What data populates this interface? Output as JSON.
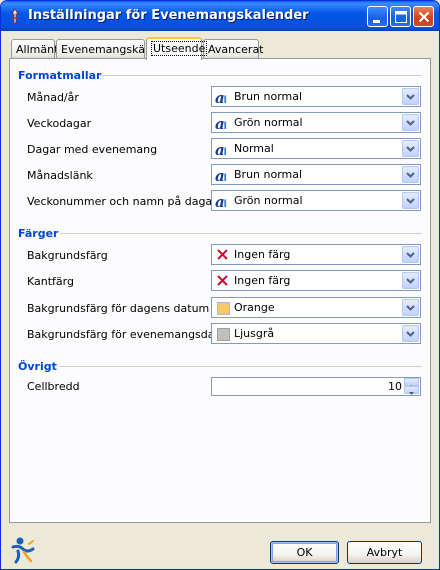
{
  "window": {
    "title": "Inställningar för Evenemangskalender"
  },
  "tabs": [
    {
      "label": "Allmänt"
    },
    {
      "label": "Evenemangskälla"
    },
    {
      "label": "Utseende",
      "active": true
    },
    {
      "label": "Avancerat"
    }
  ],
  "sections": {
    "formatmallar": {
      "title": "Formatmallar",
      "rows": [
        {
          "label": "Månad/år",
          "value": "Brun normal",
          "icon": "style-icon"
        },
        {
          "label": "Veckodagar",
          "value": "Grön normal",
          "icon": "style-icon"
        },
        {
          "label": "Dagar med evenemang",
          "value": "Normal",
          "icon": "style-icon"
        },
        {
          "label": "Månadslänk",
          "value": "Brun normal",
          "icon": "style-icon"
        },
        {
          "label": "Veckonummer och namn på dagar",
          "value": "Grön normal",
          "icon": "style-icon"
        }
      ]
    },
    "farger": {
      "title": "Färger",
      "rows": [
        {
          "label": "Bakgrundsfärg",
          "value": "Ingen färg",
          "icon": "no-color-icon"
        },
        {
          "label": "Kantfärg",
          "value": "Ingen färg",
          "icon": "no-color-icon"
        },
        {
          "label": "Bakgrundsfärg för dagens datum",
          "value": "Orange",
          "icon": "color-swatch-icon",
          "swatch": "#FFC864"
        },
        {
          "label": "Bakgrundsfärg för evenemangsdagar",
          "value": "Ljusgrå",
          "icon": "color-swatch-icon",
          "swatch": "#C0C0C0"
        }
      ]
    },
    "ovrigt": {
      "title": "Övrigt",
      "rows": [
        {
          "label": "Cellbredd",
          "value": "10"
        }
      ]
    }
  },
  "buttons": {
    "ok": "OK",
    "cancel": "Avbryt"
  },
  "colors": {
    "accent": "#0046D5",
    "titlebar": "#0054E3",
    "dialog_bg": "#ECE9D8"
  }
}
